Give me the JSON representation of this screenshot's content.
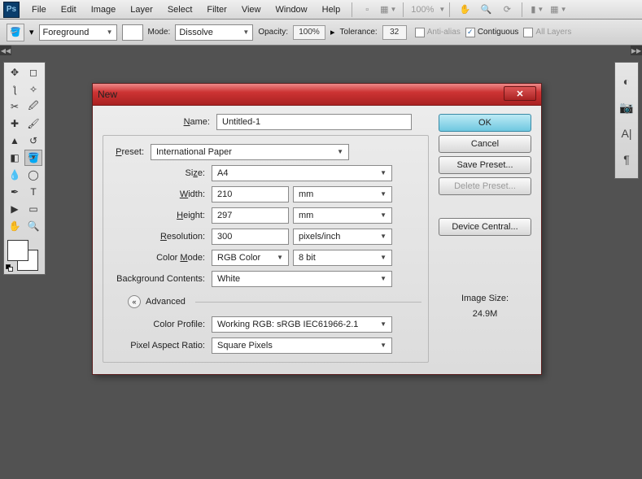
{
  "menubar": {
    "items": [
      "File",
      "Edit",
      "Image",
      "Layer",
      "Select",
      "Filter",
      "View",
      "Window",
      "Help"
    ],
    "zoom": "100%"
  },
  "optbar": {
    "fill_mode": "Foreground",
    "mode_label": "Mode:",
    "mode_value": "Dissolve",
    "opacity_label": "Opacity:",
    "opacity_value": "100%",
    "tolerance_label": "Tolerance:",
    "tolerance_value": "32",
    "antialias_label": "Anti-alias",
    "contiguous_label": "Contiguous",
    "alllayers_label": "All Layers"
  },
  "dialog": {
    "title": "New",
    "labels": {
      "name": "Name:",
      "preset": "Preset:",
      "size": "Size:",
      "width": "Width:",
      "height": "Height:",
      "resolution": "Resolution:",
      "colormode": "Color Mode:",
      "bgcontents": "Background Contents:",
      "advanced": "Advanced",
      "colorprofile": "Color Profile:",
      "pixelaspect": "Pixel Aspect Ratio:"
    },
    "values": {
      "name": "Untitled-1",
      "preset": "International Paper",
      "size": "A4",
      "width": "210",
      "width_unit": "mm",
      "height": "297",
      "height_unit": "mm",
      "resolution": "300",
      "resolution_unit": "pixels/inch",
      "colormode": "RGB Color",
      "colordepth": "8 bit",
      "bgcontents": "White",
      "colorprofile": "Working RGB:  sRGB IEC61966-2.1",
      "pixelaspect": "Square Pixels"
    },
    "buttons": {
      "ok": "OK",
      "cancel": "Cancel",
      "save_preset": "Save Preset...",
      "delete_preset": "Delete Preset...",
      "device_central": "Device Central..."
    },
    "image_size_label": "Image Size:",
    "image_size_value": "24.9M"
  }
}
